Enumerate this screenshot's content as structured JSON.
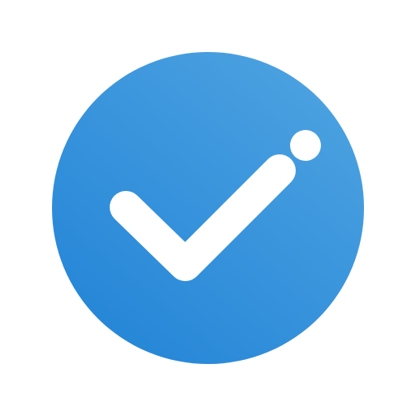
{
  "icon": {
    "name": "checkmark-circle-icon",
    "colors": {
      "background": "#ffffff",
      "circle_light": "#4ba1e0",
      "circle_dark": "#2787d8",
      "mark": "#ffffff"
    }
  }
}
